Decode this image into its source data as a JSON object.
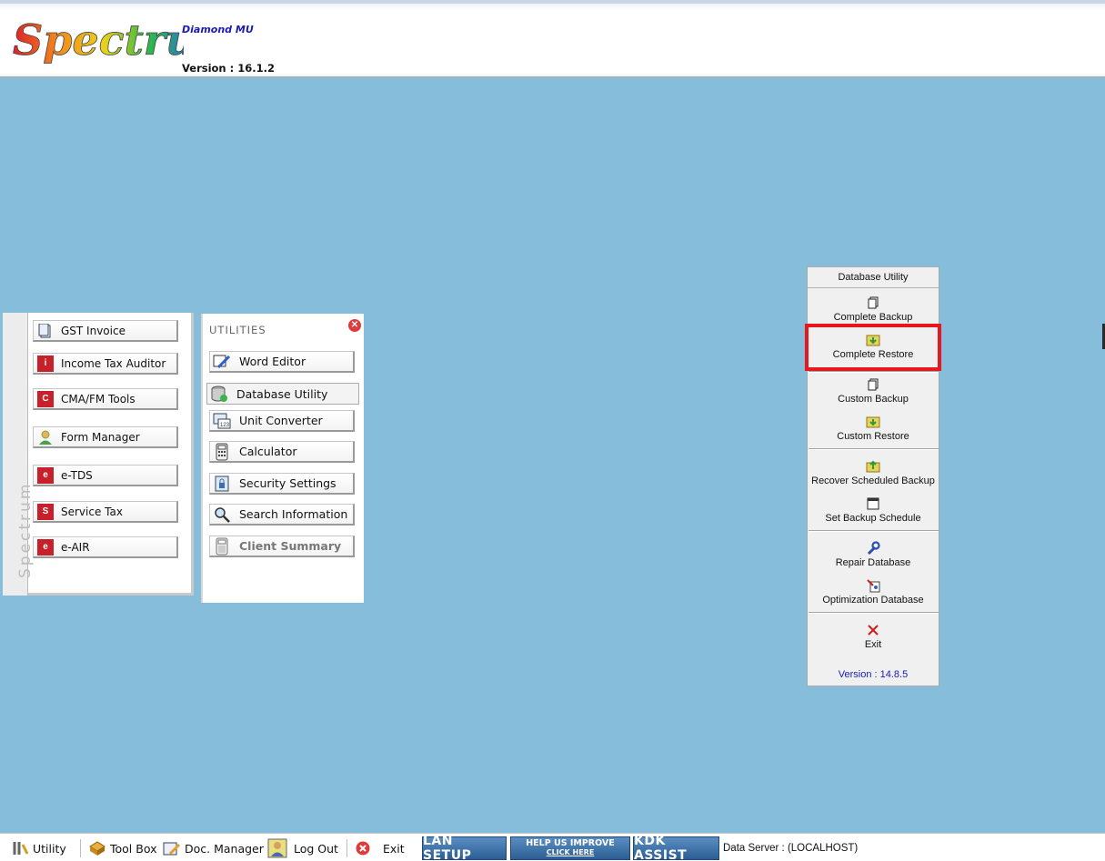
{
  "app": {
    "logo_text": "Spectrum",
    "edition": "Diamond MU",
    "version": "Version : 16.1.2"
  },
  "left_panel": {
    "tab_label": "Spectrum",
    "modules": [
      {
        "label": "GST Invoice",
        "icon": "invoice-icon"
      },
      {
        "label": "Income Tax Auditor",
        "icon": "income-tax-icon"
      },
      {
        "label": "CMA/FM Tools",
        "icon": "cma-icon"
      },
      {
        "label": "Form Manager",
        "icon": "form-manager-icon"
      },
      {
        "label": "e-TDS",
        "icon": "etds-icon"
      },
      {
        "label": "Service Tax",
        "icon": "service-tax-icon"
      },
      {
        "label": "e-AIR",
        "icon": "eair-icon"
      }
    ]
  },
  "utilities": {
    "title": "UTILITIES",
    "items": [
      {
        "label": "Word Editor",
        "icon": "word-editor-icon"
      },
      {
        "label": "Database Utility",
        "icon": "database-icon"
      },
      {
        "label": "Unit Converter",
        "icon": "unit-converter-icon"
      },
      {
        "label": "Calculator",
        "icon": "calculator-icon"
      },
      {
        "label": "Security Settings",
        "icon": "lock-icon"
      },
      {
        "label": "Search Information",
        "icon": "search-icon"
      },
      {
        "label": "Client Summary",
        "icon": "client-summary-icon"
      }
    ]
  },
  "database_utility": {
    "title": "Database Utility",
    "items": [
      {
        "label": "Complete Backup",
        "icon": "copy-icon"
      },
      {
        "label": "Complete Restore",
        "icon": "restore-folder-icon"
      },
      {
        "label": "Custom Backup",
        "icon": "copy-icon"
      },
      {
        "label": "Custom Restore",
        "icon": "restore-folder-icon"
      },
      {
        "label": "Recover Scheduled Backup",
        "icon": "recover-icon"
      },
      {
        "label": "Set Backup Schedule",
        "icon": "calendar-icon"
      },
      {
        "label": "Repair Database",
        "icon": "wrench-icon"
      },
      {
        "label": "Optimization Database",
        "icon": "optimize-icon"
      },
      {
        "label": "Exit",
        "icon": "close-x-icon"
      }
    ],
    "version": "Version : 14.8.5",
    "highlighted_item": "Complete Restore"
  },
  "taskbar": {
    "utility": "Utility",
    "toolbox": "Tool Box",
    "doc_manager": "Doc. Manager",
    "logout": "Log Out",
    "exit": "Exit",
    "lan_setup": "LAN SETUP",
    "help_line1": "HELP US IMPROVE",
    "help_line2": "CLICK HERE",
    "kdk_assist": "KDK ASSIST",
    "data_server": "Data Server : (LOCALHOST)"
  },
  "colors": {
    "desktop": "#86bddb",
    "highlight": "#e5171f",
    "version_text": "#1a1ab8"
  }
}
